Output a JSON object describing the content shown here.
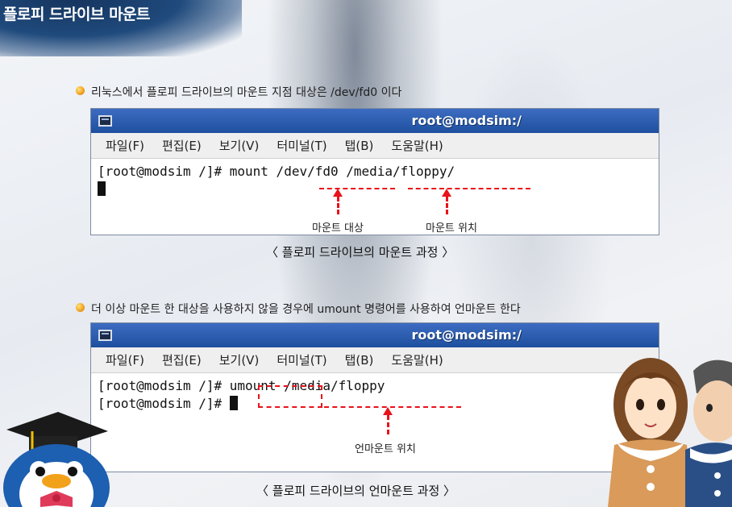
{
  "page": {
    "title": "플로피 드라이브 마운트"
  },
  "section1": {
    "bullet_text": "리눅스에서 플로피 드라이브의 마운트 지점 대상은 /dev/fd0 이다",
    "terminal": {
      "title": "root@modsim:/",
      "menu": [
        "파일(F)",
        "편집(E)",
        "보기(V)",
        "터미널(T)",
        "탭(B)",
        "도움말(H)"
      ],
      "command_line": "[root@modsim /]# mount /dev/fd0 /media/floppy/"
    },
    "annotations": {
      "target": "마운트 대상",
      "location": "마운트 위치"
    },
    "caption": "〈 플로피 드라이브의 마운트 과정 〉"
  },
  "section2": {
    "bullet_text": "더 이상 마운트 한 대상을 사용하지 않을 경우에 umount 명령어를 사용하여 언마운트 한다",
    "terminal": {
      "title": "root@modsim:/",
      "menu": [
        "파일(F)",
        "편집(E)",
        "보기(V)",
        "터미널(T)",
        "탭(B)",
        "도움말(H)"
      ],
      "command_line": "[root@modsim /]# umount /media/floppy",
      "prompt_line": "[root@modsim /]# "
    },
    "annotations": {
      "location": "언마운트 위치"
    },
    "caption": "〈 플로피 드라이브의 언마운트 과정 〉"
  },
  "colors": {
    "titlebar": "#2a5cb0",
    "highlight": "#e8121a",
    "banner": "#1f4a7c"
  }
}
